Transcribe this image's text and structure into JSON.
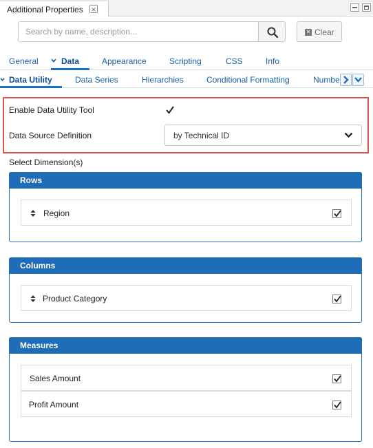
{
  "view": {
    "title": "Additional Properties",
    "close_icon": "close-icon"
  },
  "search": {
    "placeholder": "Search by name, description...",
    "clear_label": "Clear"
  },
  "main_tabs": [
    {
      "label": "General"
    },
    {
      "label": "Data",
      "active": true
    },
    {
      "label": "Appearance"
    },
    {
      "label": "Scripting"
    },
    {
      "label": "CSS"
    },
    {
      "label": "Info"
    }
  ],
  "sub_tabs": [
    {
      "label": "Data Utility",
      "active": true
    },
    {
      "label": "Data Series"
    },
    {
      "label": "Hierarchies"
    },
    {
      "label": "Conditional Formatting"
    },
    {
      "label": "Numbe"
    }
  ],
  "form": {
    "enable_label": "Enable Data Utility Tool",
    "enable_checked": true,
    "source_label": "Data Source Definition",
    "source_value": "by Technical ID",
    "select_dims_label": "Select Dimension(s)"
  },
  "panels": {
    "rows": {
      "title": "Rows",
      "items": [
        {
          "label": "Region",
          "checked": true
        }
      ]
    },
    "columns": {
      "title": "Columns",
      "items": [
        {
          "label": "Product Category",
          "checked": true
        }
      ]
    },
    "measures": {
      "title": "Measures",
      "items": [
        {
          "label": "Sales Amount",
          "checked": true
        },
        {
          "label": "Profit Amount",
          "checked": true
        }
      ]
    }
  },
  "colors": {
    "accent": "#1f6db8",
    "highlight": "#d9534f",
    "tab_text": "#1a5fa5"
  }
}
